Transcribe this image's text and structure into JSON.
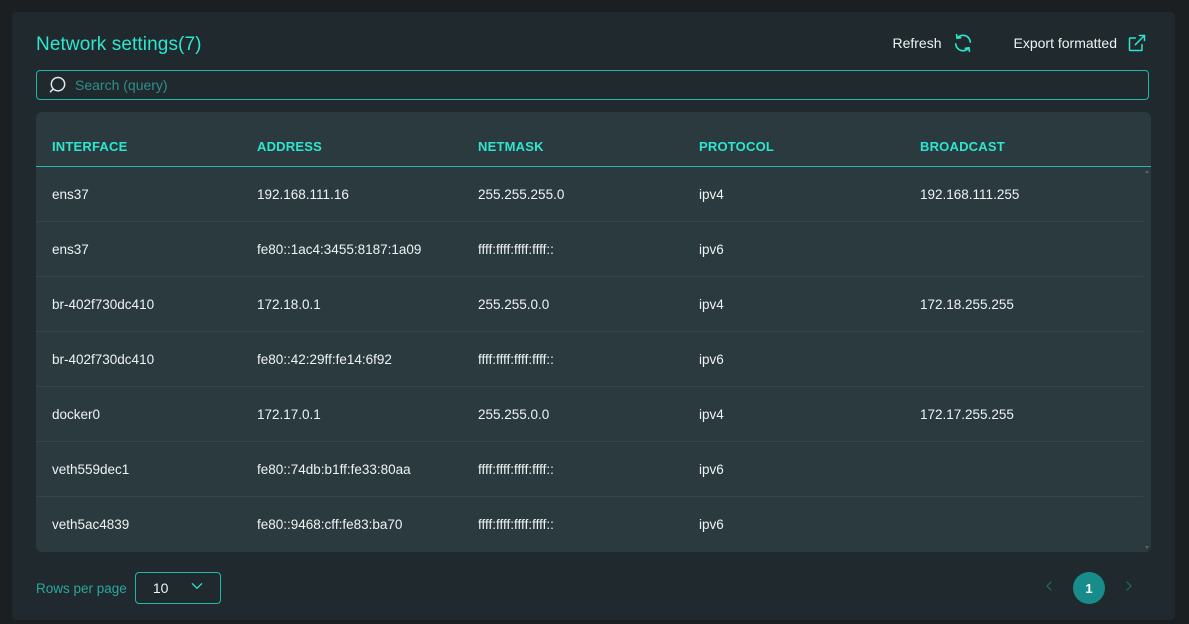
{
  "header": {
    "title": "Network settings(7)",
    "refresh_label": "Refresh",
    "export_label": "Export formatted"
  },
  "search": {
    "placeholder": "Search (query)",
    "value": ""
  },
  "table": {
    "columns": [
      "INTERFACE",
      "ADDRESS",
      "NETMASK",
      "PROTOCOL",
      "BROADCAST"
    ],
    "rows": [
      [
        "ens37",
        "192.168.111.16",
        "255.255.255.0",
        "ipv4",
        "192.168.111.255"
      ],
      [
        "ens37",
        "fe80::1ac4:3455:8187:1a09",
        "ffff:ffff:ffff:ffff::",
        "ipv6",
        ""
      ],
      [
        "br-402f730dc410",
        "172.18.0.1",
        "255.255.0.0",
        "ipv4",
        "172.18.255.255"
      ],
      [
        "br-402f730dc410",
        "fe80::42:29ff:fe14:6f92",
        "ffff:ffff:ffff:ffff::",
        "ipv6",
        ""
      ],
      [
        "docker0",
        "172.17.0.1",
        "255.255.0.0",
        "ipv4",
        "172.17.255.255"
      ],
      [
        "veth559dec1",
        "fe80::74db:b1ff:fe33:80aa",
        "ffff:ffff:ffff:ffff::",
        "ipv6",
        ""
      ],
      [
        "veth5ac4839",
        "fe80::9468:cff:fe83:ba70",
        "ffff:ffff:ffff:ffff::",
        "ipv6",
        ""
      ]
    ]
  },
  "footer": {
    "rows_per_page_label": "Rows per page",
    "rows_per_page_value": "10",
    "current_page": "1"
  },
  "colors": {
    "accent": "#2ee6d0",
    "background": "#20292d",
    "table_bg": "#2b3a3f",
    "page_active": "#178c8a"
  }
}
